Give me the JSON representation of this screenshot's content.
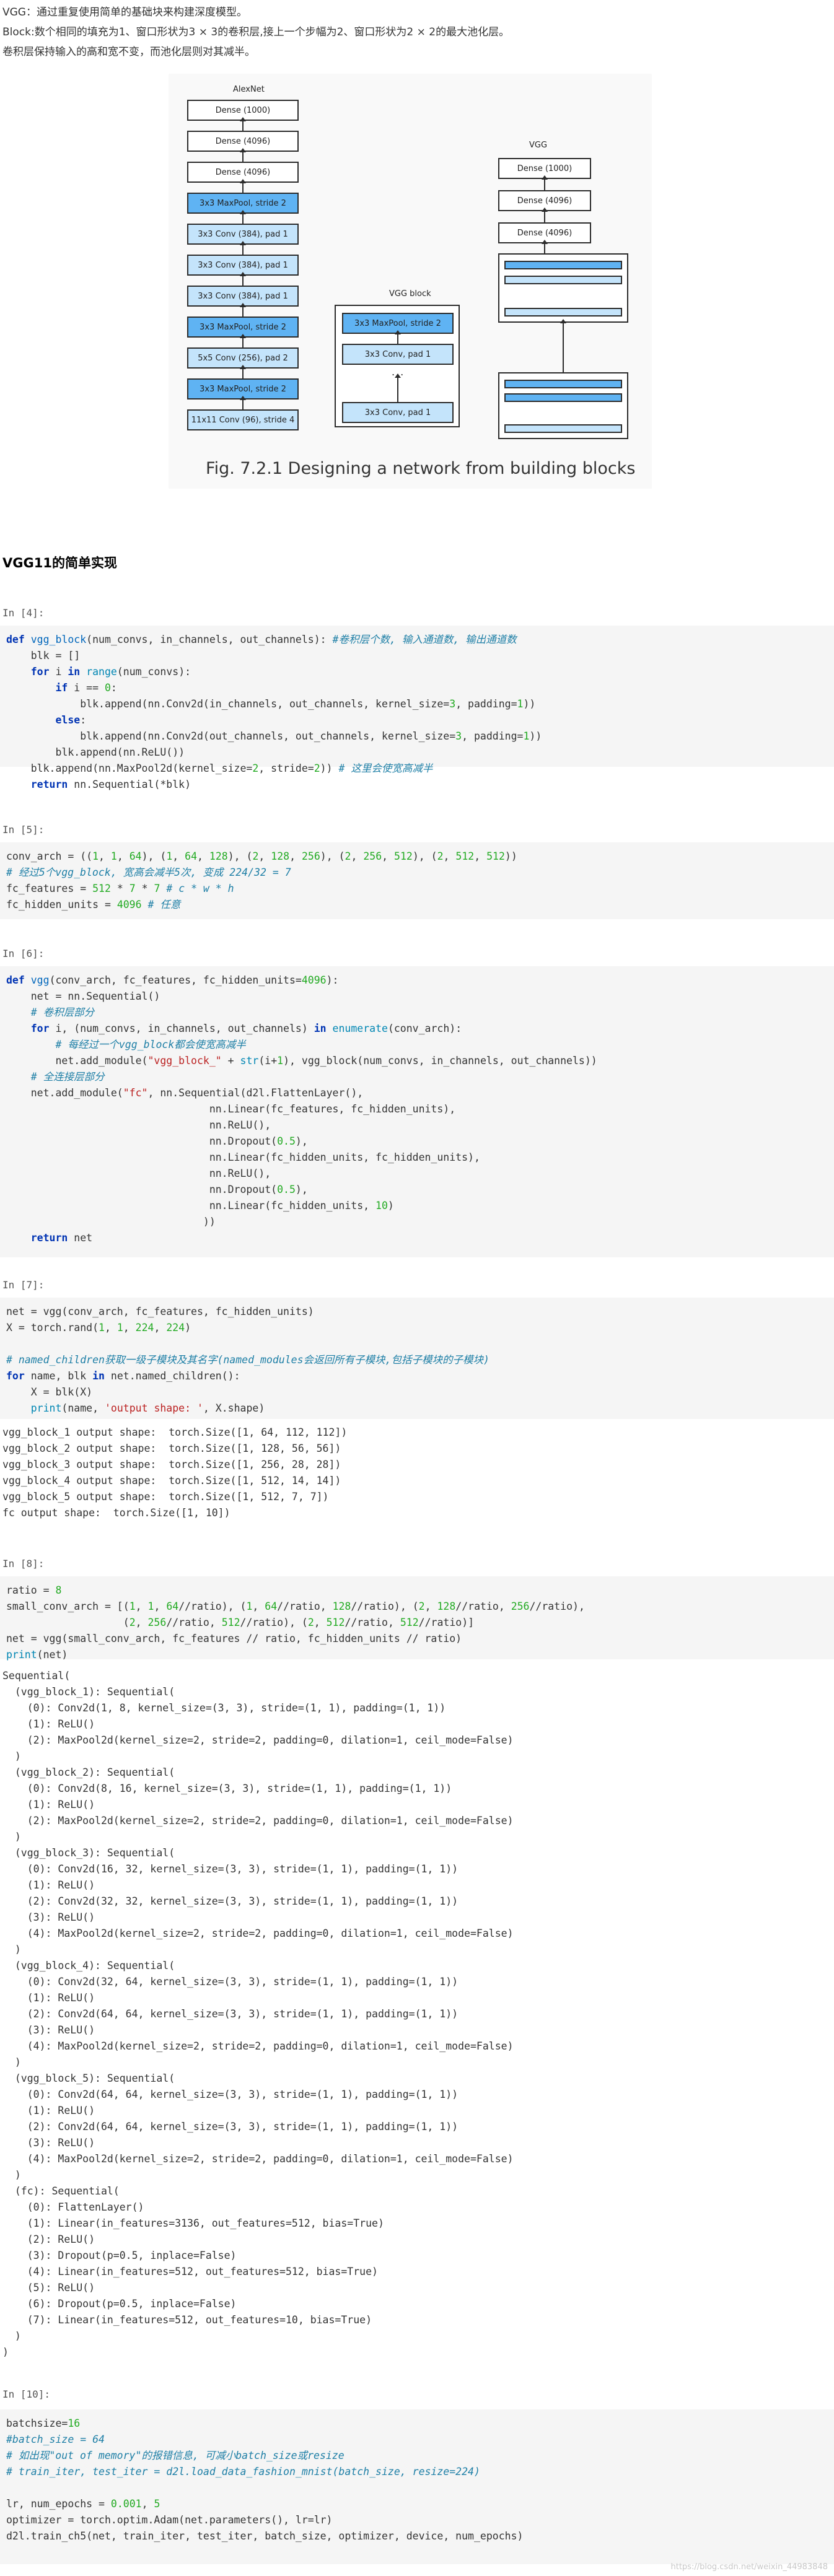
{
  "intro": {
    "line1": "VGG：通过重复使用简单的基础块来构建深度模型。",
    "line2": "Block:数个相同的填充为1、窗口形状为3 × 3的卷积层,接上一个步幅为2、窗口形状为2 × 2的最大池化层。",
    "line3": "卷积层保持输入的高和宽不变，而池化层则对其减半。"
  },
  "figure": {
    "alexnet_title": "AlexNet",
    "alexnet_layers": [
      "Dense (1000)",
      "Dense (4096)",
      "Dense (4096)",
      "3x3 MaxPool, stride 2",
      "3x3 Conv (384), pad 1",
      "3x3 Conv (384), pad 1",
      "3x3 Conv (384), pad 1",
      "3x3 MaxPool, stride 2",
      "5x5 Conv (256), pad 2",
      "3x3 MaxPool, stride 2",
      "11x11 Conv (96), stride 4"
    ],
    "vggblock_title": "VGG block",
    "vggblock_layers": [
      "3x3 MaxPool, stride 2",
      "3x3 Conv, pad 1",
      "...",
      "3x3 Conv, pad 1"
    ],
    "vgg_title": "VGG",
    "vgg_layers": [
      "Dense (1000)",
      "Dense (4096)",
      "Dense (4096)"
    ],
    "caption": "Fig. 7.2.1  Designing a network from building blocks",
    "colors": {
      "maxpool": "#5fb3f3",
      "conv": "#c4e4fb",
      "border": "#2b2b2b"
    }
  },
  "heading": "VGG11的简单实现",
  "cells": [
    {
      "prompt": "In [4]:"
    },
    {
      "prompt": "In [5]:"
    },
    {
      "prompt": "In [6]:"
    },
    {
      "prompt": "In [7]:",
      "output": "vgg_block_1 output shape:  torch.Size([1, 64, 112, 112])\nvgg_block_2 output shape:  torch.Size([1, 128, 56, 56])\nvgg_block_3 output shape:  torch.Size([1, 256, 28, 28])\nvgg_block_4 output shape:  torch.Size([1, 512, 14, 14])\nvgg_block_5 output shape:  torch.Size([1, 512, 7, 7])\nfc output shape:  torch.Size([1, 10])"
    },
    {
      "prompt": "In [8]:",
      "output": "Sequential(\n  (vgg_block_1): Sequential(\n    (0): Conv2d(1, 8, kernel_size=(3, 3), stride=(1, 1), padding=(1, 1))\n    (1): ReLU()\n    (2): MaxPool2d(kernel_size=2, stride=2, padding=0, dilation=1, ceil_mode=False)\n  )\n  (vgg_block_2): Sequential(\n    (0): Conv2d(8, 16, kernel_size=(3, 3), stride=(1, 1), padding=(1, 1))\n    (1): ReLU()\n    (2): MaxPool2d(kernel_size=2, stride=2, padding=0, dilation=1, ceil_mode=False)\n  )\n  (vgg_block_3): Sequential(\n    (0): Conv2d(16, 32, kernel_size=(3, 3), stride=(1, 1), padding=(1, 1))\n    (1): ReLU()\n    (2): Conv2d(32, 32, kernel_size=(3, 3), stride=(1, 1), padding=(1, 1))\n    (3): ReLU()\n    (4): MaxPool2d(kernel_size=2, stride=2, padding=0, dilation=1, ceil_mode=False)\n  )\n  (vgg_block_4): Sequential(\n    (0): Conv2d(32, 64, kernel_size=(3, 3), stride=(1, 1), padding=(1, 1))\n    (1): ReLU()\n    (2): Conv2d(64, 64, kernel_size=(3, 3), stride=(1, 1), padding=(1, 1))\n    (3): ReLU()\n    (4): MaxPool2d(kernel_size=2, stride=2, padding=0, dilation=1, ceil_mode=False)\n  )\n  (vgg_block_5): Sequential(\n    (0): Conv2d(64, 64, kernel_size=(3, 3), stride=(1, 1), padding=(1, 1))\n    (1): ReLU()\n    (2): Conv2d(64, 64, kernel_size=(3, 3), stride=(1, 1), padding=(1, 1))\n    (3): ReLU()\n    (4): MaxPool2d(kernel_size=2, stride=2, padding=0, dilation=1, ceil_mode=False)\n  )\n  (fc): Sequential(\n    (0): FlattenLayer()\n    (1): Linear(in_features=3136, out_features=512, bias=True)\n    (2): ReLU()\n    (3): Dropout(p=0.5, inplace=False)\n    (4): Linear(in_features=512, out_features=512, bias=True)\n    (5): ReLU()\n    (6): Dropout(p=0.5, inplace=False)\n    (7): Linear(in_features=512, out_features=10, bias=True)\n  )\n)"
    },
    {
      "prompt": "In [10]:"
    }
  ],
  "watermark": "https://blog.csdn.net/weixin_44983848"
}
